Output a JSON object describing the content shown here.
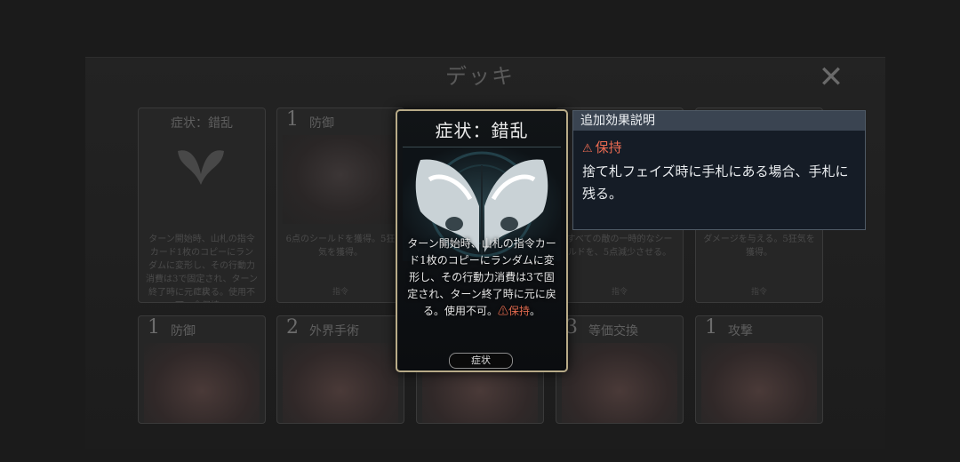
{
  "screen": {
    "title": "デッキ",
    "close_icon": "close-x-icon"
  },
  "background_cards_row1": [
    {
      "cost": "",
      "name": "症状：錯乱",
      "desc": "ターン開始時、山札の指令カード1枚のコピーにランダムに変形し、その行動力消費は3で固定され、ターン終了時に元に戻る。使用不可。⚠保持。",
      "type": "症状"
    },
    {
      "cost": "1",
      "name": "防御",
      "desc": "6点のシールドを獲得。5狂気を獲得。",
      "type": "指令"
    },
    {
      "cost": "",
      "name": "",
      "desc": "すべての敵の一時的なシールドを、5点減少させる。",
      "type": "指令"
    },
    {
      "cost": "",
      "name": "",
      "desc": "ダメージを与える。5狂気を獲得。",
      "type": "指令"
    }
  ],
  "background_cards_row2": [
    {
      "cost": "1",
      "name": "防御"
    },
    {
      "cost": "2",
      "name": "外界手術"
    },
    {
      "cost": "",
      "name": ""
    },
    {
      "cost": "3",
      "name": "等価交換"
    },
    {
      "cost": "1",
      "name": "攻撃"
    }
  ],
  "focus_card": {
    "name": "症状：錯乱",
    "desc_main": "ターン開始時、山札の指令カード1枚のコピーにランダムに変形し、その行動力消費は3で固定され、ターン終了時に元に戻る。使用不可。",
    "desc_keyword": "⚠保持",
    "desc_end": "。",
    "type": "症状",
    "art_icon": "butterfly-skull-icon"
  },
  "tooltip": {
    "header": "追加効果説明",
    "keyword_icon": "⚠",
    "keyword": "保持",
    "body": "捨て札フェイズ時に手札にある場合、手札に残る。"
  },
  "colors": {
    "frame_gold": "#b8ab88",
    "warning_red": "#e06a4e",
    "tooltip_bg": "#151c26",
    "tooltip_header": "#3a4451"
  }
}
